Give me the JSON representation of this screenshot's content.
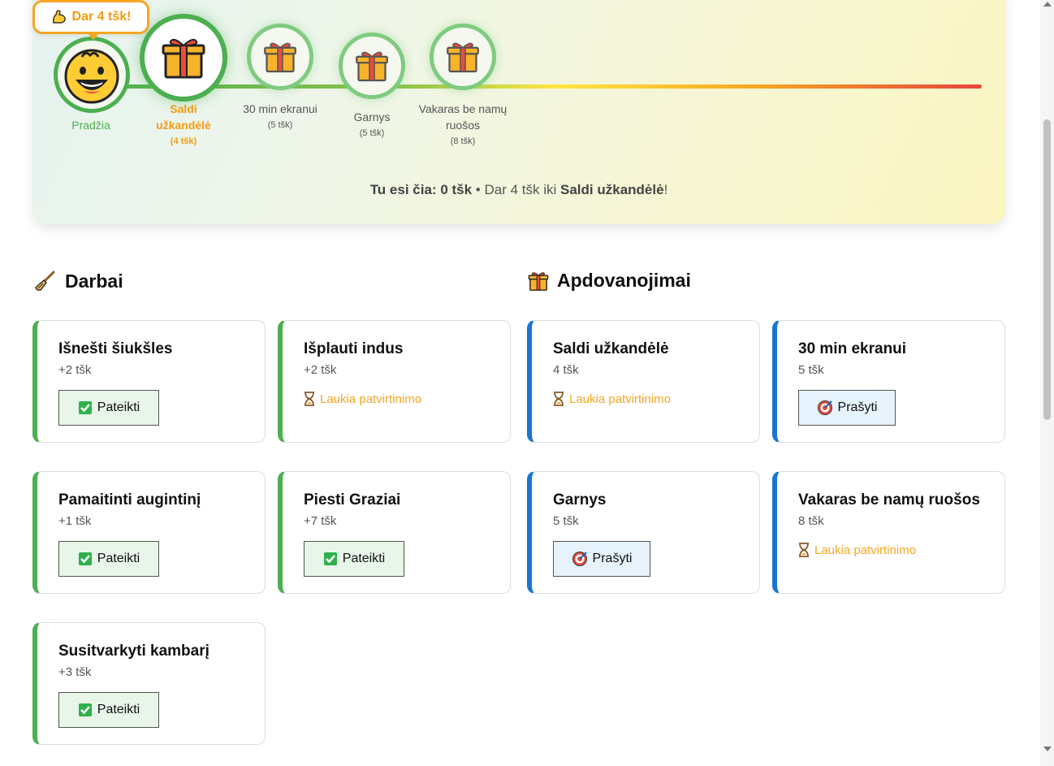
{
  "progress": {
    "bubble_text": "Dar 4 tšk!",
    "nodes": [
      {
        "label": "Pradžia",
        "points": ""
      },
      {
        "label": "Saldi užkandėlė",
        "points": "(4 tšk)"
      },
      {
        "label": "30 min ekranui",
        "points": "(5 tšk)"
      },
      {
        "label": "Garnys",
        "points": "(5 tšk)"
      },
      {
        "label": "Vakaras be namų ruošos",
        "points": "(8 tšk)"
      }
    ],
    "status": {
      "prefix": "Tu esi čia:",
      "current": "0 tšk",
      "separator": "•",
      "middle": "Dar 4 tšk iki",
      "target": "Saldi užkandėlė",
      "suffix": "!"
    },
    "colors": {
      "accent_green": "#4caf50",
      "accent_orange": "#f39c12"
    }
  },
  "chores": {
    "title": "Darbai",
    "icon": "broom-icon",
    "items": [
      {
        "name": "Išnešti šiukšles",
        "points": "+2 tšk",
        "state": "button",
        "action": "Pateikti"
      },
      {
        "name": "Išplauti indus",
        "points": "+2 tšk",
        "state": "pending",
        "pending_text": "Laukia patvirtinimo"
      },
      {
        "name": "Pamaitinti augintinį",
        "points": "+1 tšk",
        "state": "button",
        "action": "Pateikti"
      },
      {
        "name": "Piesti Graziai",
        "points": "+7 tšk",
        "state": "button",
        "action": "Pateikti"
      },
      {
        "name": "Susitvarkyti kambarį",
        "points": "+3 tšk",
        "state": "button",
        "action": "Pateikti"
      }
    ]
  },
  "rewards": {
    "title": "Apdovanojimai",
    "icon": "gift-icon",
    "items": [
      {
        "name": "Saldi užkandėlė",
        "points": "4 tšk",
        "state": "pending",
        "pending_text": "Laukia patvirtinimo"
      },
      {
        "name": "30 min ekranui",
        "points": "5 tšk",
        "state": "button",
        "action": "Prašyti"
      },
      {
        "name": "Garnys",
        "points": "5 tšk",
        "state": "button",
        "action": "Prašyti"
      },
      {
        "name": "Vakaras be namų ruošos",
        "points": "8 tšk",
        "state": "pending",
        "pending_text": "Laukia patvirtinimo"
      }
    ]
  }
}
